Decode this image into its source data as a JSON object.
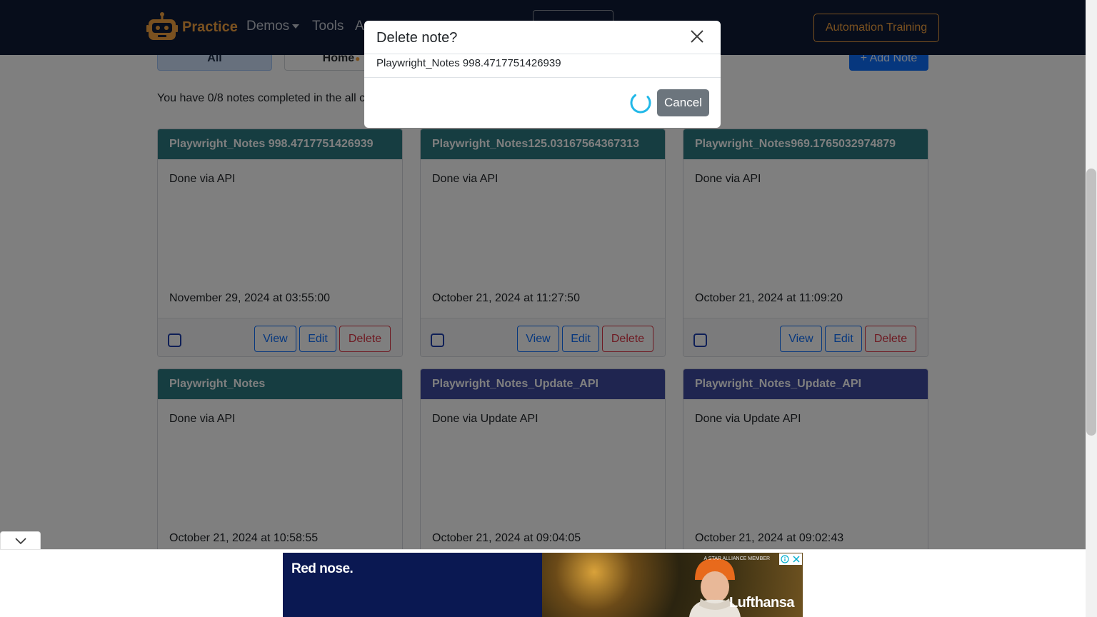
{
  "navbar": {
    "brand": "Practice",
    "links": [
      "Demos",
      "Tools",
      "A"
    ],
    "training_button": "Automation Training",
    "brand_color": "#f4a340"
  },
  "tabs": [
    "All",
    "Home"
  ],
  "add_note_button": "+ Add Note",
  "progress_text": "You have 0/8 notes completed in the all c",
  "notes": [
    {
      "title": "Playwright_Notes 998.4717751426939",
      "body": "Done via API",
      "date": "November 29, 2024 at 03:55:00",
      "category_color": "#2d7a82"
    },
    {
      "title": "Playwright_Notes125.03167564367313",
      "body": "Done via API",
      "date": "October 21, 2024 at 11:27:50",
      "category_color": "#2d7a82"
    },
    {
      "title": "Playwright_Notes969.1765032974879",
      "body": "Done via API",
      "date": "October 21, 2024 at 11:09:20",
      "category_color": "#2d7a82"
    },
    {
      "title": "Playwright_Notes",
      "body": "Done via API",
      "date": "October 21, 2024 at 10:58:55",
      "category_color": "#2d7a82"
    },
    {
      "title": "Playwright_Notes_Update_API",
      "body": "Done via Update API",
      "date": "October 21, 2024 at 09:04:05",
      "category_color": "#3f4aa1"
    },
    {
      "title": "Playwright_Notes_Update_API",
      "body": "Done via Update API",
      "date": "October 21, 2024 at 09:02:43",
      "category_color": "#3f4aa1"
    }
  ],
  "card_buttons": {
    "view": "View",
    "edit": "Edit",
    "delete": "Delete"
  },
  "modal": {
    "title": "Delete note?",
    "body": "Playwright_Notes 998.4717751426939",
    "cancel_label": "Cancel"
  },
  "ad": {
    "headline": "Red nose.",
    "brand": "Lufthansa",
    "tag": "A STAR ALLIANCE MEMBER"
  }
}
